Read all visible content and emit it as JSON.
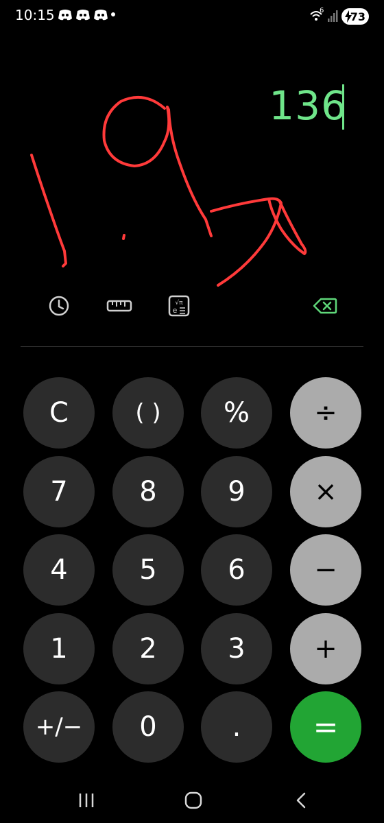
{
  "status_bar": {
    "time": "10:15",
    "notification_icons": [
      "discord-icon",
      "discord-icon",
      "discord-icon"
    ],
    "wifi_label": "6",
    "battery": "73"
  },
  "display": {
    "result": "136",
    "result_color": "#6fe58a",
    "scribble_color": "#ff3a3a"
  },
  "tools": [
    "history-icon",
    "unit-converter-icon",
    "scientific-mode-icon",
    "backspace-icon"
  ],
  "keypad": {
    "rows": [
      [
        "C",
        "( )",
        "%",
        "÷"
      ],
      [
        "7",
        "8",
        "9",
        "×"
      ],
      [
        "4",
        "5",
        "6",
        "−"
      ],
      [
        "1",
        "2",
        "3",
        "+"
      ],
      [
        "+/−",
        "0",
        ".",
        "="
      ]
    ],
    "colors": {
      "digit_bg": "#2c2c2c",
      "operator_bg": "#ababab",
      "equals_bg": "#22a534"
    }
  },
  "nav_bar": [
    "recent-apps-icon",
    "home-icon",
    "back-icon"
  ]
}
